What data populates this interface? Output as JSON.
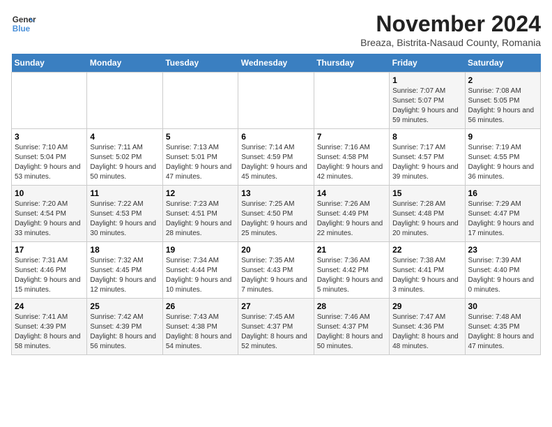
{
  "logo": {
    "line1": "General",
    "line2": "Blue"
  },
  "title": "November 2024",
  "subtitle": "Breaza, Bistrita-Nasaud County, Romania",
  "days_of_week": [
    "Sunday",
    "Monday",
    "Tuesday",
    "Wednesday",
    "Thursday",
    "Friday",
    "Saturday"
  ],
  "weeks": [
    [
      {
        "day": "",
        "info": ""
      },
      {
        "day": "",
        "info": ""
      },
      {
        "day": "",
        "info": ""
      },
      {
        "day": "",
        "info": ""
      },
      {
        "day": "",
        "info": ""
      },
      {
        "day": "1",
        "info": "Sunrise: 7:07 AM\nSunset: 5:07 PM\nDaylight: 9 hours and 59 minutes."
      },
      {
        "day": "2",
        "info": "Sunrise: 7:08 AM\nSunset: 5:05 PM\nDaylight: 9 hours and 56 minutes."
      }
    ],
    [
      {
        "day": "3",
        "info": "Sunrise: 7:10 AM\nSunset: 5:04 PM\nDaylight: 9 hours and 53 minutes."
      },
      {
        "day": "4",
        "info": "Sunrise: 7:11 AM\nSunset: 5:02 PM\nDaylight: 9 hours and 50 minutes."
      },
      {
        "day": "5",
        "info": "Sunrise: 7:13 AM\nSunset: 5:01 PM\nDaylight: 9 hours and 47 minutes."
      },
      {
        "day": "6",
        "info": "Sunrise: 7:14 AM\nSunset: 4:59 PM\nDaylight: 9 hours and 45 minutes."
      },
      {
        "day": "7",
        "info": "Sunrise: 7:16 AM\nSunset: 4:58 PM\nDaylight: 9 hours and 42 minutes."
      },
      {
        "day": "8",
        "info": "Sunrise: 7:17 AM\nSunset: 4:57 PM\nDaylight: 9 hours and 39 minutes."
      },
      {
        "day": "9",
        "info": "Sunrise: 7:19 AM\nSunset: 4:55 PM\nDaylight: 9 hours and 36 minutes."
      }
    ],
    [
      {
        "day": "10",
        "info": "Sunrise: 7:20 AM\nSunset: 4:54 PM\nDaylight: 9 hours and 33 minutes."
      },
      {
        "day": "11",
        "info": "Sunrise: 7:22 AM\nSunset: 4:53 PM\nDaylight: 9 hours and 30 minutes."
      },
      {
        "day": "12",
        "info": "Sunrise: 7:23 AM\nSunset: 4:51 PM\nDaylight: 9 hours and 28 minutes."
      },
      {
        "day": "13",
        "info": "Sunrise: 7:25 AM\nSunset: 4:50 PM\nDaylight: 9 hours and 25 minutes."
      },
      {
        "day": "14",
        "info": "Sunrise: 7:26 AM\nSunset: 4:49 PM\nDaylight: 9 hours and 22 minutes."
      },
      {
        "day": "15",
        "info": "Sunrise: 7:28 AM\nSunset: 4:48 PM\nDaylight: 9 hours and 20 minutes."
      },
      {
        "day": "16",
        "info": "Sunrise: 7:29 AM\nSunset: 4:47 PM\nDaylight: 9 hours and 17 minutes."
      }
    ],
    [
      {
        "day": "17",
        "info": "Sunrise: 7:31 AM\nSunset: 4:46 PM\nDaylight: 9 hours and 15 minutes."
      },
      {
        "day": "18",
        "info": "Sunrise: 7:32 AM\nSunset: 4:45 PM\nDaylight: 9 hours and 12 minutes."
      },
      {
        "day": "19",
        "info": "Sunrise: 7:34 AM\nSunset: 4:44 PM\nDaylight: 9 hours and 10 minutes."
      },
      {
        "day": "20",
        "info": "Sunrise: 7:35 AM\nSunset: 4:43 PM\nDaylight: 9 hours and 7 minutes."
      },
      {
        "day": "21",
        "info": "Sunrise: 7:36 AM\nSunset: 4:42 PM\nDaylight: 9 hours and 5 minutes."
      },
      {
        "day": "22",
        "info": "Sunrise: 7:38 AM\nSunset: 4:41 PM\nDaylight: 9 hours and 3 minutes."
      },
      {
        "day": "23",
        "info": "Sunrise: 7:39 AM\nSunset: 4:40 PM\nDaylight: 9 hours and 0 minutes."
      }
    ],
    [
      {
        "day": "24",
        "info": "Sunrise: 7:41 AM\nSunset: 4:39 PM\nDaylight: 8 hours and 58 minutes."
      },
      {
        "day": "25",
        "info": "Sunrise: 7:42 AM\nSunset: 4:39 PM\nDaylight: 8 hours and 56 minutes."
      },
      {
        "day": "26",
        "info": "Sunrise: 7:43 AM\nSunset: 4:38 PM\nDaylight: 8 hours and 54 minutes."
      },
      {
        "day": "27",
        "info": "Sunrise: 7:45 AM\nSunset: 4:37 PM\nDaylight: 8 hours and 52 minutes."
      },
      {
        "day": "28",
        "info": "Sunrise: 7:46 AM\nSunset: 4:37 PM\nDaylight: 8 hours and 50 minutes."
      },
      {
        "day": "29",
        "info": "Sunrise: 7:47 AM\nSunset: 4:36 PM\nDaylight: 8 hours and 48 minutes."
      },
      {
        "day": "30",
        "info": "Sunrise: 7:48 AM\nSunset: 4:35 PM\nDaylight: 8 hours and 47 minutes."
      }
    ]
  ]
}
